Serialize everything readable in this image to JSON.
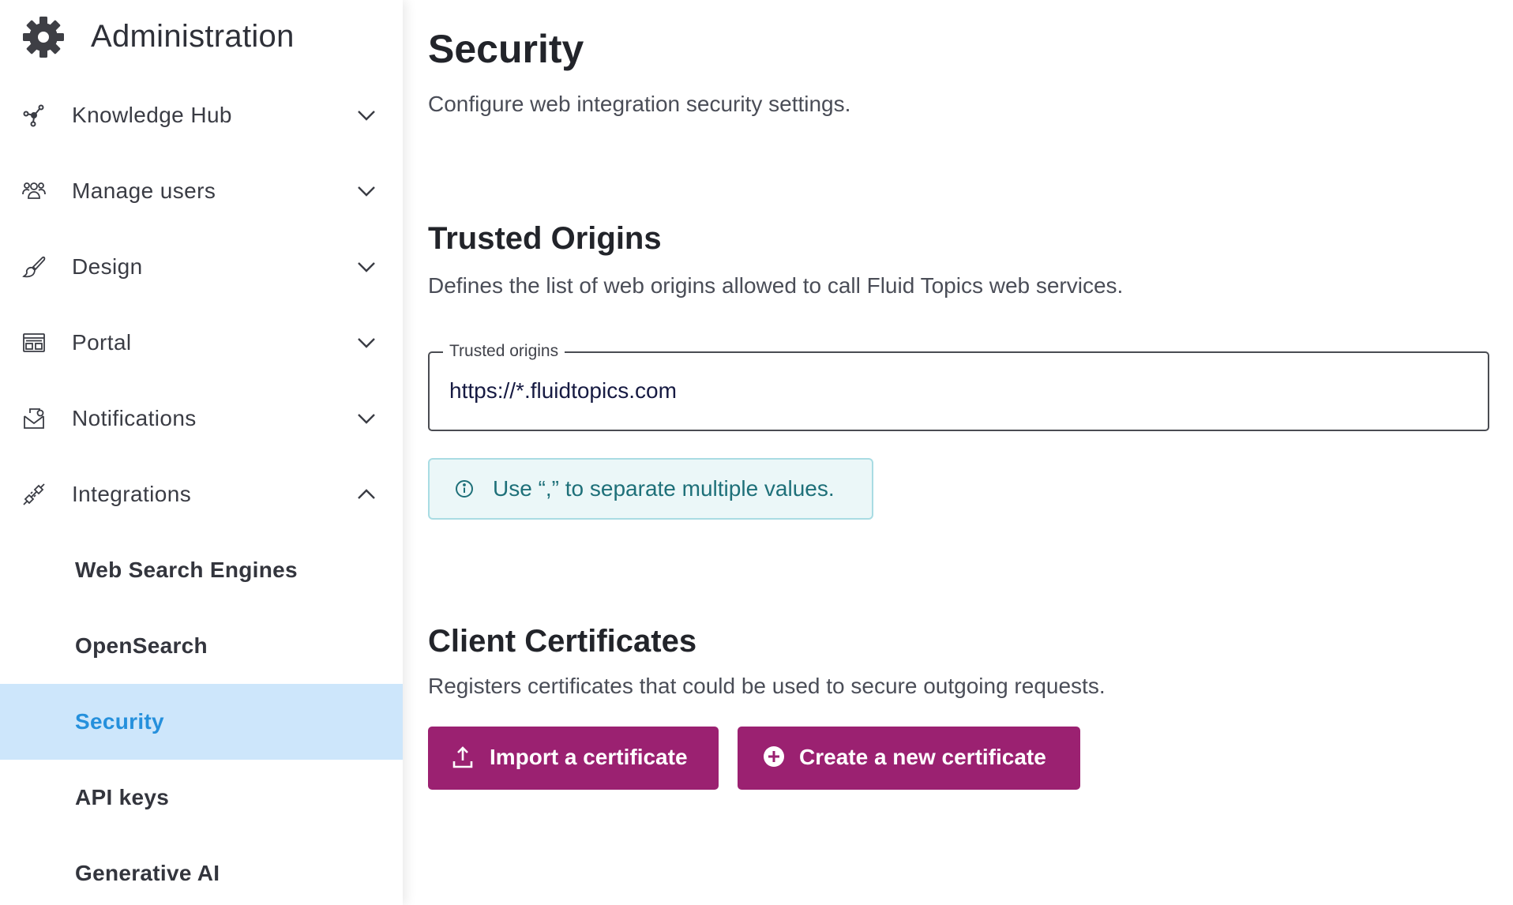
{
  "sidebar": {
    "header": {
      "title": "Administration",
      "icon": "gear-icon"
    },
    "items": [
      {
        "label": "Knowledge Hub",
        "icon": "knowledge-hub-icon",
        "expanded": false
      },
      {
        "label": "Manage users",
        "icon": "users-icon",
        "expanded": false
      },
      {
        "label": "Design",
        "icon": "brush-icon",
        "expanded": false
      },
      {
        "label": "Portal",
        "icon": "portal-icon",
        "expanded": false
      },
      {
        "label": "Notifications",
        "icon": "notifications-icon",
        "expanded": false
      },
      {
        "label": "Integrations",
        "icon": "integrations-icon",
        "expanded": true
      }
    ],
    "subitems": [
      {
        "label": "Web Search Engines",
        "active": false
      },
      {
        "label": "OpenSearch",
        "active": false
      },
      {
        "label": "Security",
        "active": true
      },
      {
        "label": "API keys",
        "active": false
      },
      {
        "label": "Generative AI",
        "active": false
      }
    ]
  },
  "main": {
    "title": "Security",
    "subtitle": "Configure web integration security settings.",
    "trusted_origins": {
      "title": "Trusted Origins",
      "description": "Defines the list of web origins allowed to call Fluid Topics web services.",
      "field_label": "Trusted origins",
      "field_value": "https://*.fluidtopics.com",
      "info_text": "Use “,” to separate multiple values.",
      "info_icon": "info-icon"
    },
    "client_certificates": {
      "title": "Client Certificates",
      "description": "Registers certificates that could be used to secure outgoing requests.",
      "import_button": "Import a certificate",
      "import_icon": "upload-icon",
      "create_button": "Create a new certificate",
      "create_icon": "add-circle-icon"
    }
  },
  "colors": {
    "accent": "#9b2171",
    "active_bg": "#cde6fb",
    "active_text": "#2590dc",
    "info_bg": "#ebf7f8",
    "info_border": "#a9dce3",
    "info_text": "#1e7079"
  }
}
